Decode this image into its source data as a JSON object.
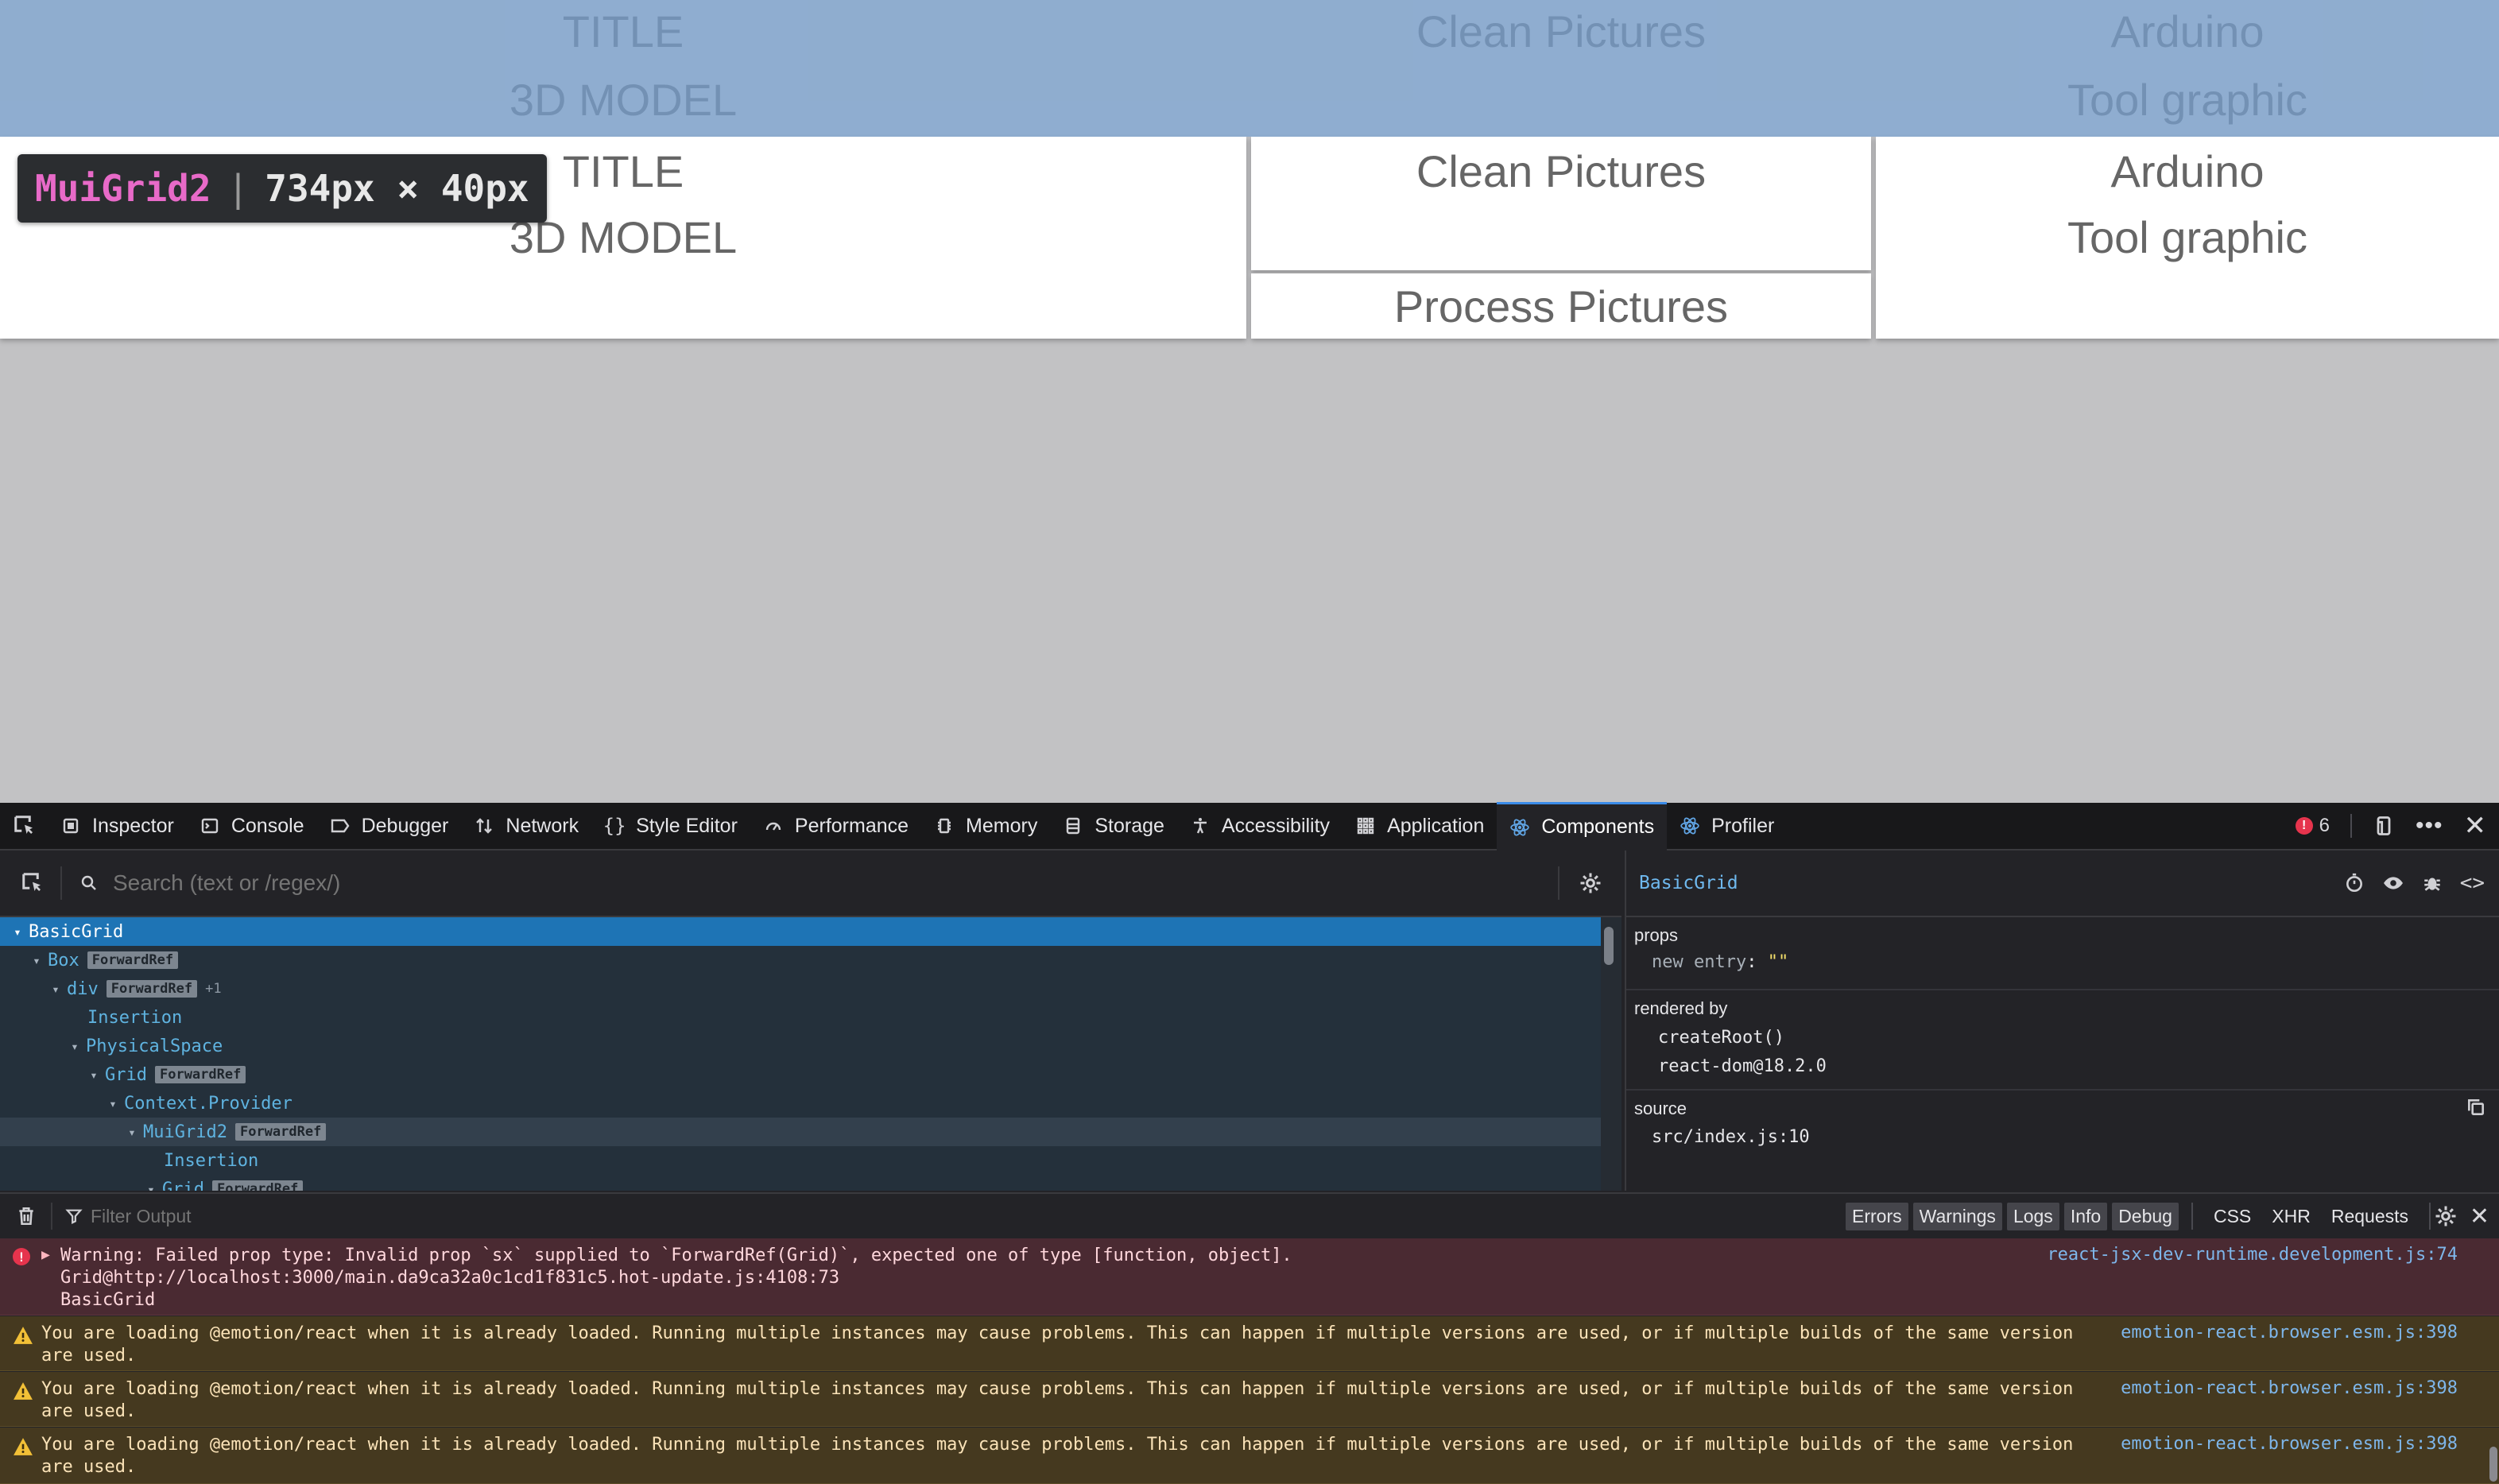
{
  "page": {
    "cards_normal": {
      "c1": [
        "TITLE",
        "3D MODEL"
      ],
      "c2": [
        "Clean Pictures",
        "Process Pictures"
      ],
      "c3": [
        "Arduino",
        "Tool graphic"
      ]
    },
    "highlight": {
      "c1": [
        "TITLE",
        "3D MODEL"
      ],
      "c2": [
        "Clean Pictures"
      ],
      "c3": [
        "Arduino",
        "Tool graphic"
      ]
    },
    "tooltip": {
      "name": "MuiGrid2",
      "dims": "734px × 40px"
    }
  },
  "devtools": {
    "tabs": [
      "Inspector",
      "Console",
      "Debugger",
      "Network",
      "Style Editor",
      "Performance",
      "Memory",
      "Storage",
      "Accessibility",
      "Application",
      "Components",
      "Profiler"
    ],
    "active_tab": "Components",
    "error_count": "6",
    "search_placeholder": "Search (text or /regex/)",
    "tree": [
      {
        "label": "BasicGrid"
      },
      {
        "label": "Box",
        "badge": "ForwardRef"
      },
      {
        "label": "div",
        "badge": "ForwardRef",
        "extra": "+1"
      },
      {
        "label": "Insertion"
      },
      {
        "label": "PhysicalSpace"
      },
      {
        "label": "Grid",
        "badge": "ForwardRef"
      },
      {
        "label": "Context.Provider"
      },
      {
        "label": "MuiGrid2",
        "badge": "ForwardRef"
      },
      {
        "label": "Insertion"
      },
      {
        "label": "Grid",
        "badge": "ForwardRef"
      }
    ],
    "selected_component": "BasicGrid",
    "props": {
      "title": "props",
      "new_entry_key": "new entry",
      "new_entry_value": "\"\"",
      "rendered_by_title": "rendered by",
      "rendered_by": [
        "createRoot()",
        "react-dom@18.2.0"
      ],
      "source_title": "source",
      "source": "src/index.js:10"
    },
    "console": {
      "filter_placeholder": "Filter Output",
      "filters": [
        "Errors",
        "Warnings",
        "Logs",
        "Info",
        "Debug"
      ],
      "net_filters": [
        "CSS",
        "XHR",
        "Requests"
      ],
      "messages": [
        {
          "type": "error",
          "text": "Warning: Failed prop type: Invalid prop `sx` supplied to `ForwardRef(Grid)`, expected one of type [function, object].\nGrid@http://localhost:3000/main.da9ca32a0c1cd1f831c5.hot-update.js:4108:73\nBasicGrid",
          "source": "react-jsx-dev-runtime.development.js:74"
        },
        {
          "type": "warn",
          "text": "You are loading @emotion/react when it is already loaded. Running multiple instances may cause problems. This can happen if multiple versions are used, or if multiple builds of the same version\nare used.",
          "source": "emotion-react.browser.esm.js:398"
        },
        {
          "type": "warn",
          "text": "You are loading @emotion/react when it is already loaded. Running multiple instances may cause problems. This can happen if multiple versions are used, or if multiple builds of the same version\nare used.",
          "source": "emotion-react.browser.esm.js:398"
        },
        {
          "type": "warn",
          "text": "You are loading @emotion/react when it is already loaded. Running multiple instances may cause problems. This can happen if multiple versions are used, or if multiple builds of the same version\nare used.",
          "source": "emotion-react.browser.esm.js:398"
        }
      ]
    }
  }
}
